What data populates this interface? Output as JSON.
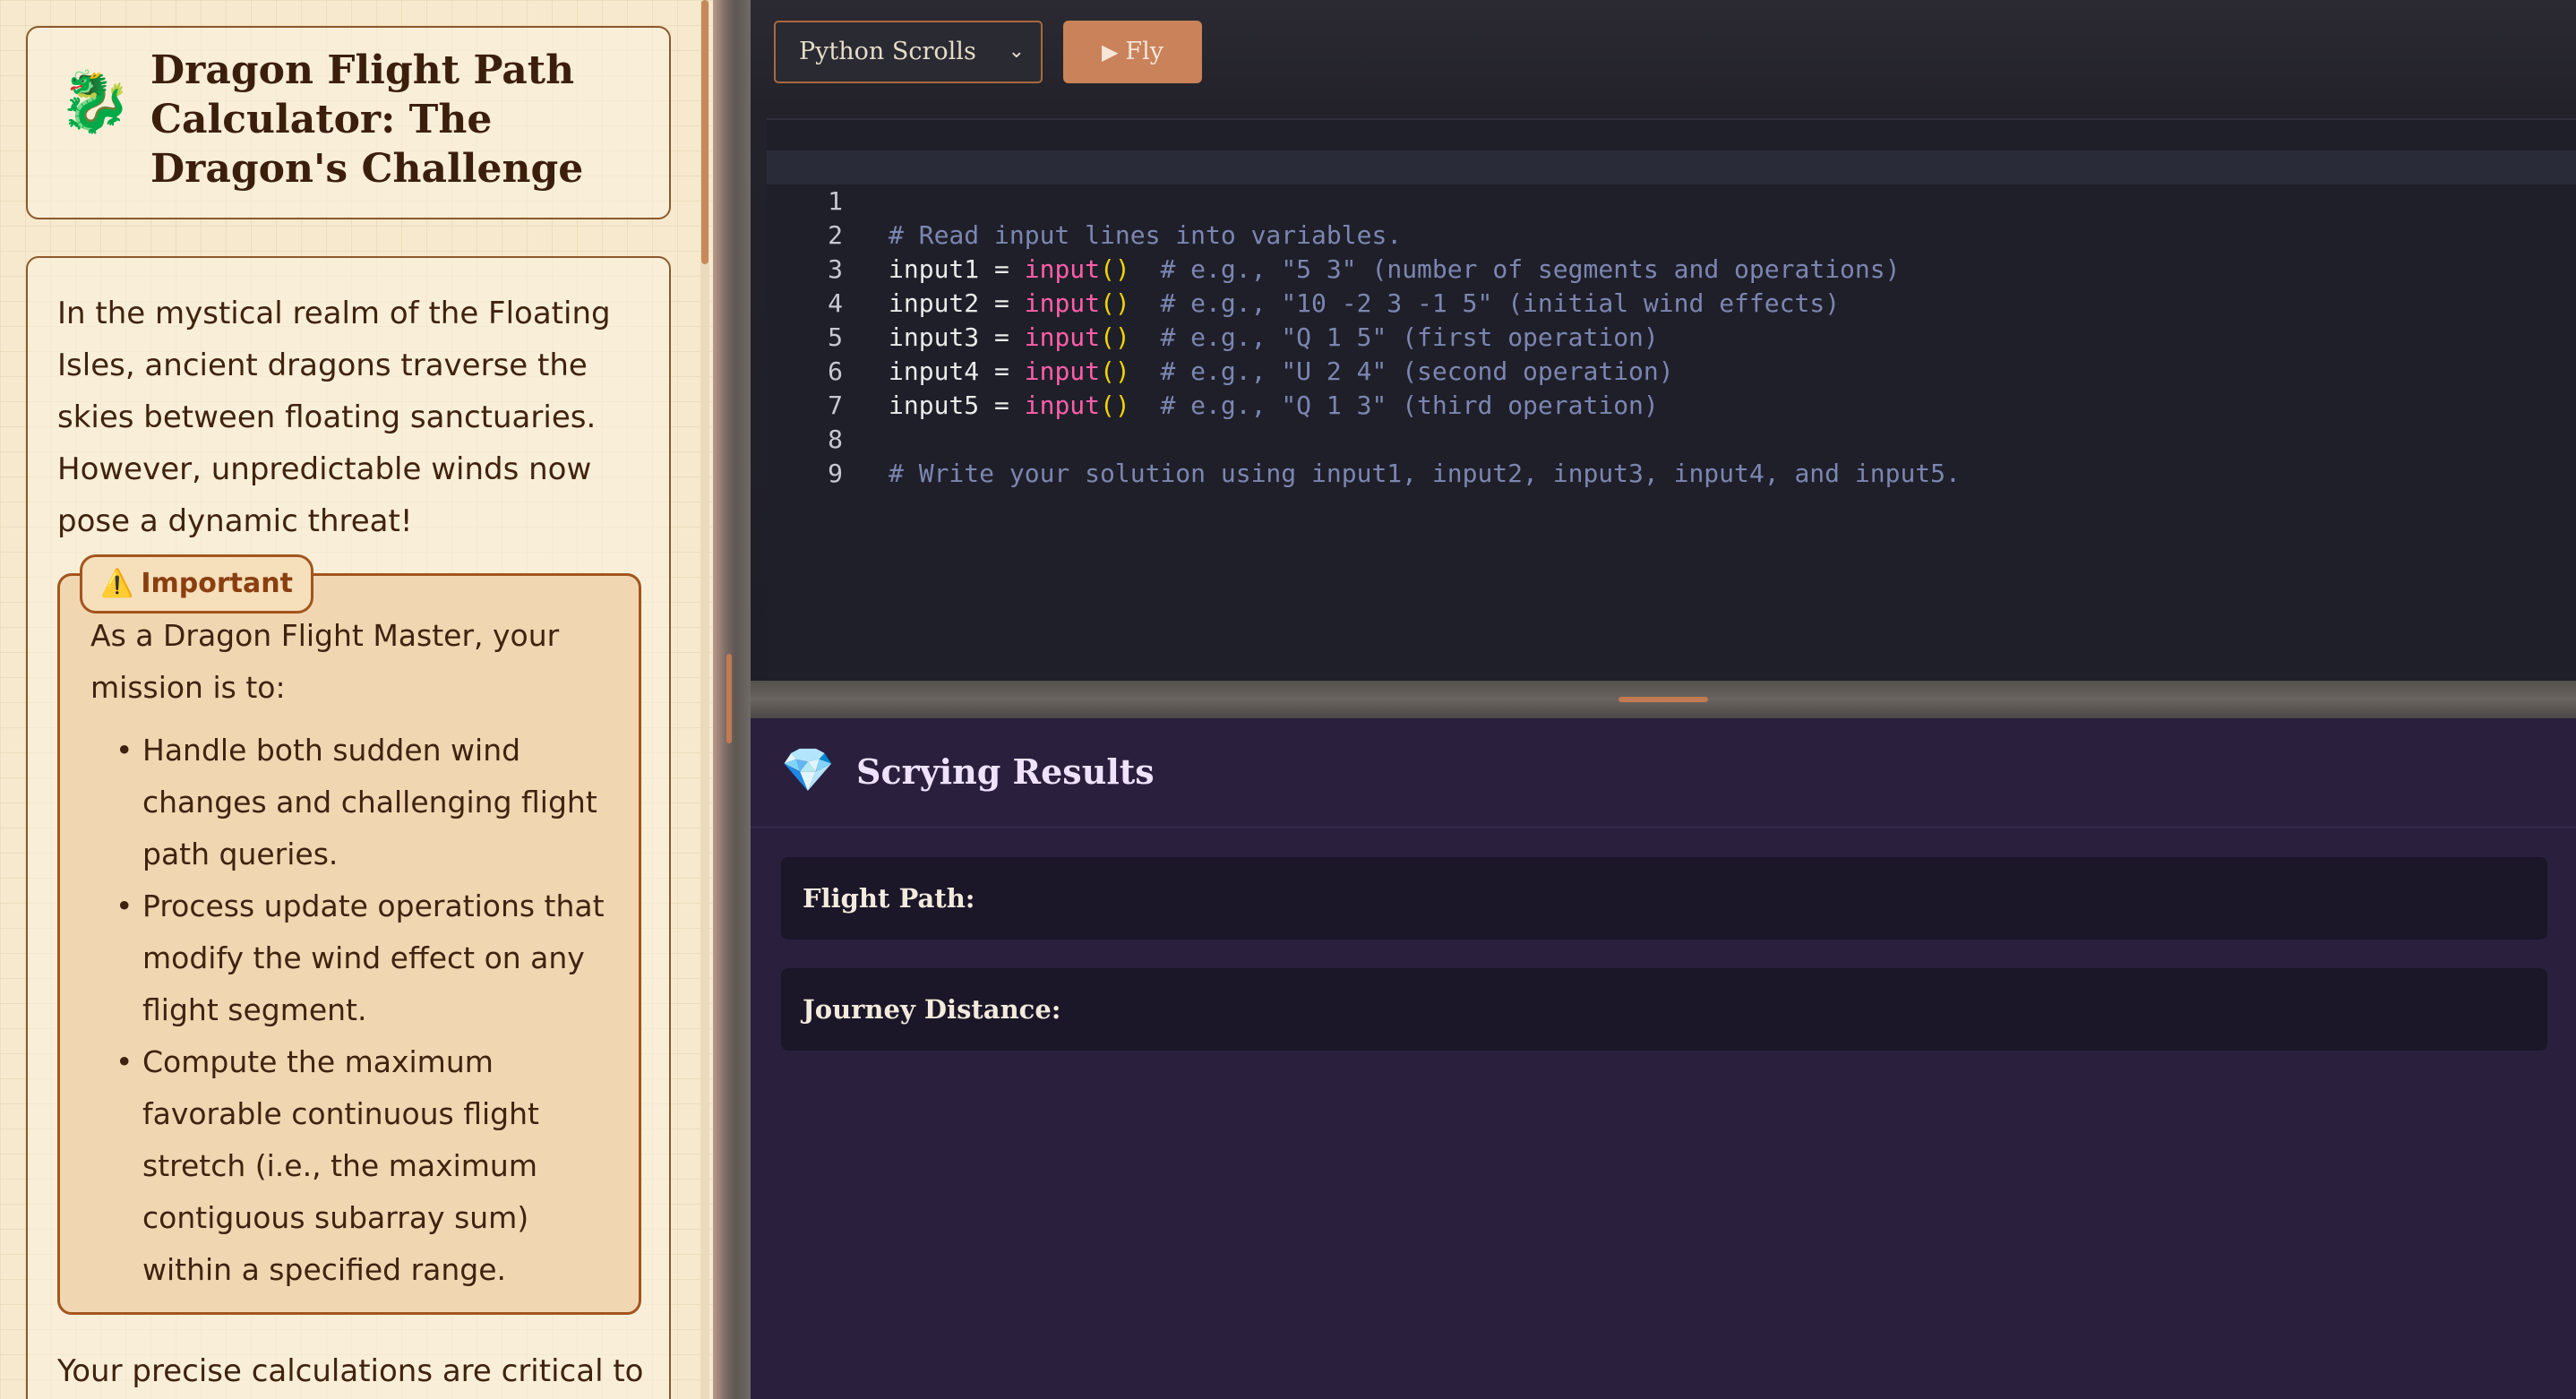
{
  "problem": {
    "title": "Dragon Flight Path Calculator: The Dragon's Challenge",
    "intro": "In the mystical realm of the Floating Isles, ancient dragons traverse the skies between floating sanctuaries. However, unpredictable winds now pose a dynamic threat!",
    "important": {
      "label": "Important",
      "mission": "As a Dragon Flight Master, your mission is to:",
      "items": [
        "Handle both sudden wind changes and challenging flight path queries.",
        "Process update operations that modify the wind effect on any flight segment.",
        "Compute the maximum favorable continuous flight stretch (i.e., the maximum contiguous subarray sum) within a specified range."
      ]
    },
    "outro": "Your precise calculations are critical to"
  },
  "toolbar": {
    "language": "Python Scrolls",
    "run_label": "Fly"
  },
  "editor": {
    "lines": [
      {
        "n": "1",
        "var": "",
        "comment": "# Read input lines into variables."
      },
      {
        "n": "2",
        "var": "input1",
        "comment": "# e.g., \"5 3\" (number of segments and operations)"
      },
      {
        "n": "3",
        "var": "input2",
        "comment": "# e.g., \"10 -2 3 -1 5\" (initial wind effects)"
      },
      {
        "n": "4",
        "var": "input3",
        "comment": "# e.g., \"Q 1 5\" (first operation)"
      },
      {
        "n": "5",
        "var": "input4",
        "comment": "# e.g., \"U 2 4\" (second operation)"
      },
      {
        "n": "6",
        "var": "input5",
        "comment": "# e.g., \"Q 1 3\" (third operation)"
      },
      {
        "n": "7",
        "var": "",
        "comment": ""
      },
      {
        "n": "8",
        "var": "",
        "comment": "# Write your solution using input1, input2, input3, input4, and input5."
      },
      {
        "n": "9",
        "var": "",
        "comment": ""
      }
    ],
    "func_name": "input",
    "parens": "()"
  },
  "results": {
    "title": "Scrying Results",
    "flight_path_label": "Flight Path:",
    "journey_distance_label": "Journey Distance:"
  },
  "icons": {
    "title_icon": "dragon-icon",
    "important_icon": "warning-icon",
    "run_icon": "play-icon",
    "results_icon": "gem-icon"
  },
  "colors": {
    "accent": "#c9825a",
    "parchment": "#f6e9cd",
    "results_bg": "#2a1f3d",
    "editor_bg": "#1f1f2a"
  }
}
